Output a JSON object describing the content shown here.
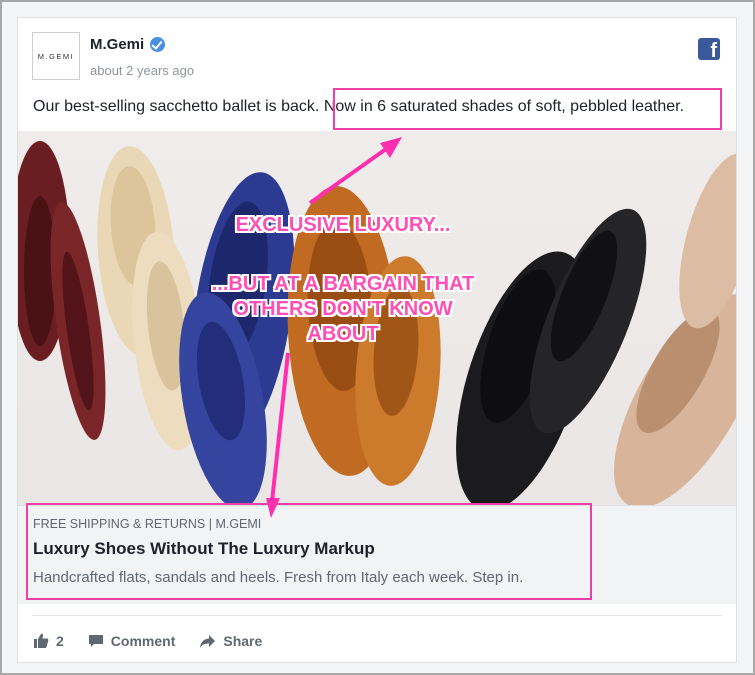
{
  "post": {
    "logo_text": "M.GEMI",
    "page_name": "M.Gemi",
    "timestamp": "about 2 years ago",
    "text_part1": "Our best-selling sacchetto ballet is back.",
    "text_part2": "Now in 6 saturated shades of soft, pebbled leather."
  },
  "annotations": {
    "line1": "EXCLUSIVE LUXURY...",
    "line2": "...BUT AT A BARGAIN THAT",
    "line3": "OTHERS DON'T KNOW",
    "line4": "ABOUT",
    "color": "#ff4fb5"
  },
  "link": {
    "domain": "FREE SHIPPING & RETURNS | M.GEMI",
    "headline": "Luxury Shoes Without The Luxury Markup",
    "description": "Handcrafted flats, sandals and heels. Fresh from Italy each week. Step in."
  },
  "actions": {
    "like_count": "2",
    "comment_label": "Comment",
    "share_label": "Share"
  },
  "icons": [
    "verified-badge-icon",
    "facebook-icon",
    "like-icon",
    "comment-icon",
    "share-icon"
  ]
}
